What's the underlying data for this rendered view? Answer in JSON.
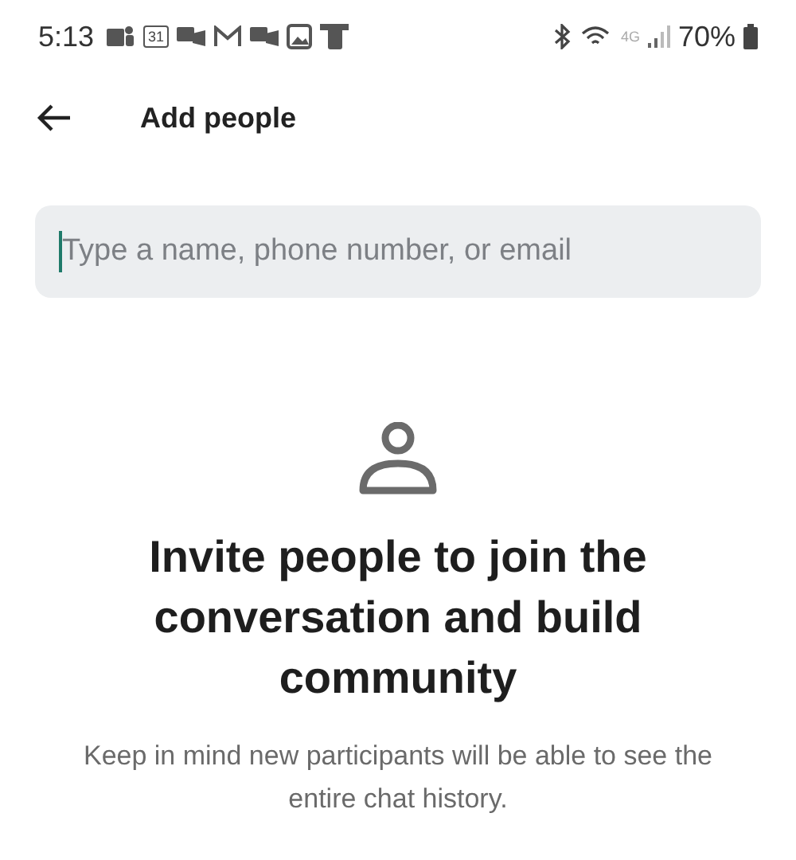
{
  "status_bar": {
    "time": "5:13",
    "calendar_day": "31",
    "network": "4G",
    "battery": "70%"
  },
  "header": {
    "title": "Add people"
  },
  "search": {
    "placeholder": "Type a name, phone number, or email"
  },
  "empty_state": {
    "heading": "Invite people to join the conversation and build community",
    "message": "Keep in mind new participants will be able to see the entire chat history."
  }
}
